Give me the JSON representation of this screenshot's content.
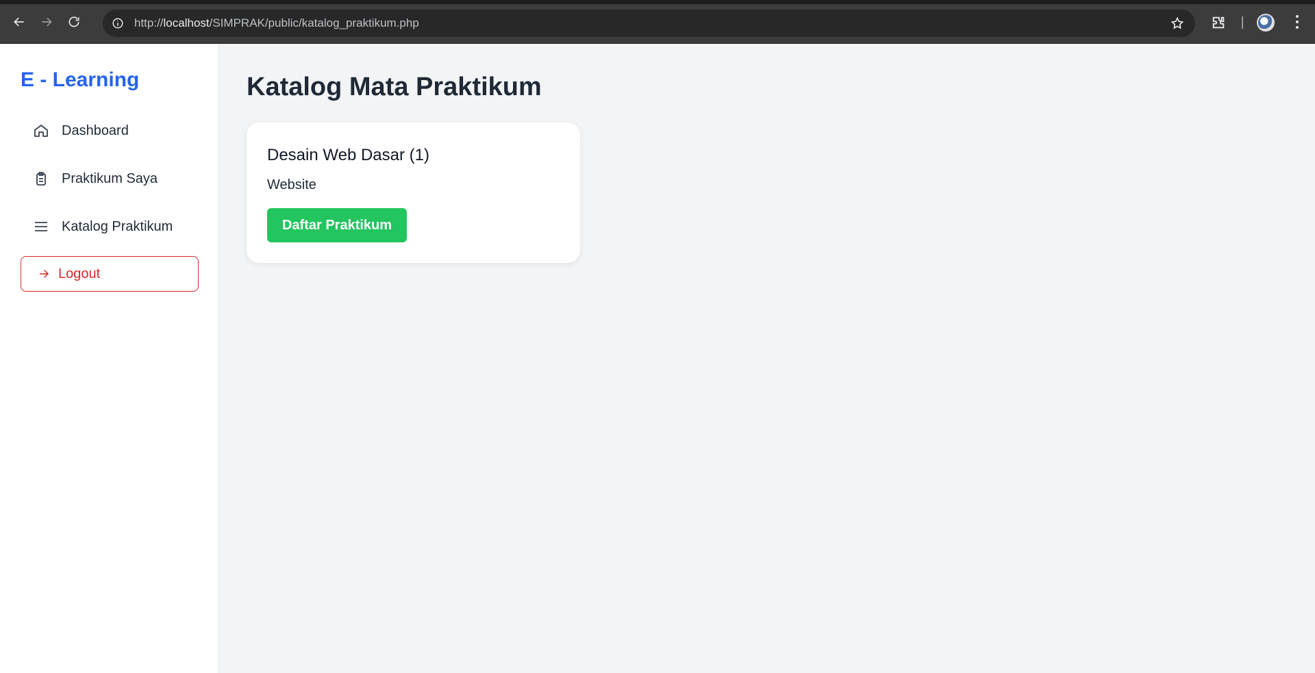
{
  "browser": {
    "url_prefix": "http://",
    "url_host": "localhost",
    "url_path": "/SIMPRAK/public/katalog_praktikum.php"
  },
  "sidebar": {
    "brand": "E - Learning",
    "items": [
      {
        "label": "Dashboard",
        "icon": "home-icon"
      },
      {
        "label": "Praktikum Saya",
        "icon": "clipboard-icon"
      },
      {
        "label": "Katalog Praktikum",
        "icon": "menu-lines-icon"
      }
    ],
    "logout_label": "Logout"
  },
  "main": {
    "title": "Katalog Mata Praktikum",
    "cards": [
      {
        "title": "Desain Web Dasar (1)",
        "subtitle": "Website",
        "button": "Daftar Praktikum"
      }
    ]
  },
  "colors": {
    "brand": "#2563eb",
    "primary_button": "#22c55e",
    "logout": "#dc2626",
    "background": "#f3f4f6"
  }
}
